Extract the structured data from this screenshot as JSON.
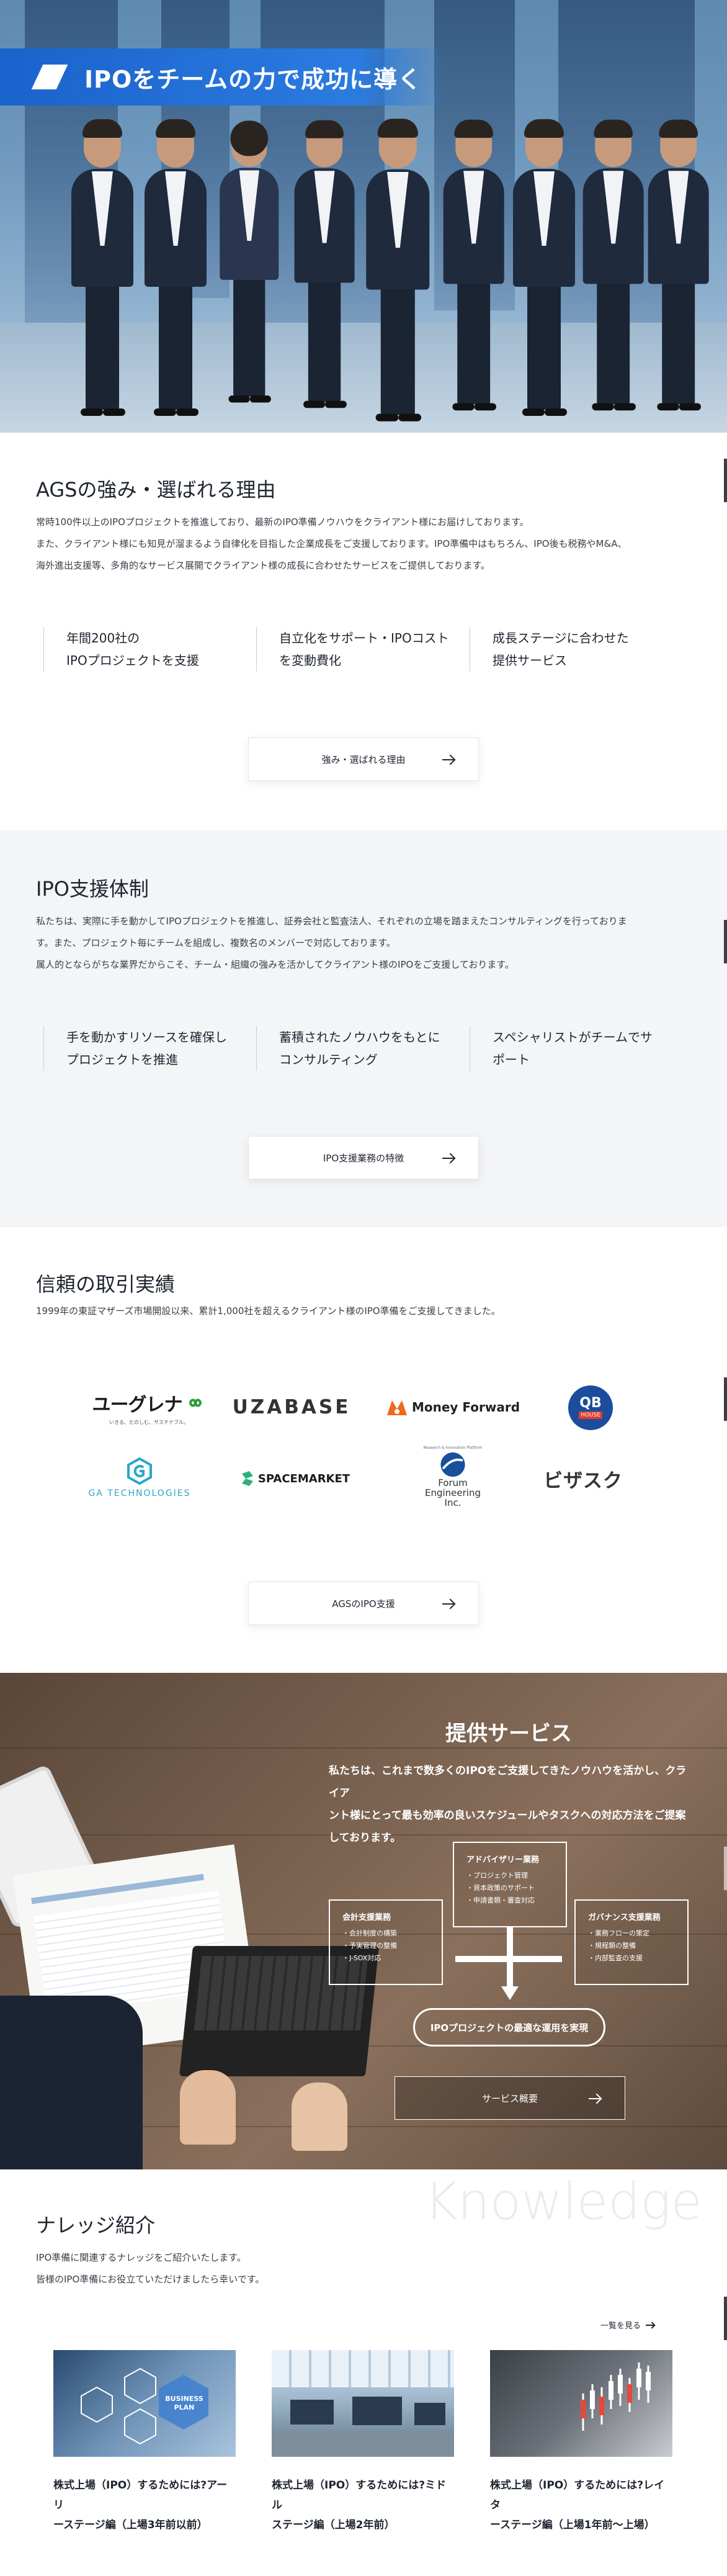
{
  "hero": {
    "title": "IPOをチームの力で成功に導く"
  },
  "strengths": {
    "title": "AGSの強み・選ばれる理由",
    "desc": [
      "常時100件以上のIPOプロジェクトを推進しており、最新のIPO準備ノウハウをクライアント様にお届けしております。",
      "また、クライアント様にも知見が溜まるよう自律化を目指した企業成長をご支援しております。IPO準備中はもちろん、IPO後も税務やM&A、",
      "海外進出支援等、多角的なサービス展開でクライアント様の成長に合わせたサービスをご提供しております。"
    ],
    "features": [
      [
        "年間200社の",
        "IPOプロジェクトを支援"
      ],
      [
        "自立化をサポート・IPOコスト",
        "を変動費化"
      ],
      [
        "成長ステージに合わせた",
        "提供サービス"
      ]
    ],
    "button": "強み・選ばれる理由"
  },
  "support": {
    "title": "IPO支援体制",
    "desc": [
      "私たちは、実際に手を動かしてIPOプロジェクトを推進し、証券会社と監査法人、それぞれの立場を踏まえたコンサルティングを行っておりま",
      "す。また、プロジェクト毎にチームを組成し、複数名のメンバーで対応しております。",
      "属人的とならがちな業界だからこそ、チーム・組織の強みを活かしてクライアント様のIPOをご支援しております。"
    ],
    "features": [
      [
        "手を動かすリソースを確保し",
        "プロジェクトを推進"
      ],
      [
        "蓄積されたノウハウをもとに",
        "コンサルティング"
      ],
      [
        "スペシャリストがチームでサ",
        "ポート"
      ]
    ],
    "button": "IPO支援業務の特徴"
  },
  "clients": {
    "title": "信頼の取引実績",
    "desc": "1999年の東証マザーズ市場開設以来、累計1,000社を超えるクライアント様のIPO準備をご支援してきました。",
    "logos": [
      {
        "name": "ユーグレナ",
        "sub": "いきる、たのしむ、サステナブル。",
        "icon": "euglena-logo-icon",
        "color": "#2f9d3a"
      },
      {
        "name": "UZABASE",
        "icon": "uzabase-logo-icon",
        "color": "#333333"
      },
      {
        "name": "Money Forward",
        "icon": "moneyforward-logo-icon",
        "color": "#f06a1d"
      },
      {
        "name": "QB HOUSE",
        "icon": "qbhouse-logo-icon",
        "color": "#1c4d9c"
      },
      {
        "name": "GA TECHNOLOGIES",
        "icon": "ga-technologies-logo-icon",
        "color": "#2aa6c8"
      },
      {
        "name": "SPACEMARKET",
        "icon": "spacemarket-logo-icon",
        "color": "#1b1b1b"
      },
      {
        "name": "Forum Engineering Inc.",
        "sub": "Research & Innovation Platform",
        "icon": "forum-engineering-logo-icon",
        "color": "#1a4f9c"
      },
      {
        "name": "ビザスク",
        "icon": "visasq-logo-icon",
        "color": "#333333"
      }
    ],
    "button": "AGSのIPO支援"
  },
  "services": {
    "title": "提供サービス",
    "desc": [
      "私たちは、これまで数多くのIPOをご支援してきたノウハウを活かし、クライア",
      "ント様にとって最も効率の良いスケジュールやタスクへの対応方法をご提案",
      "しております。"
    ],
    "boxes": {
      "advisory": {
        "title": "アドバイザリー業務",
        "items": [
          "・プロジェクト管理",
          "・資本政策のサポート",
          "・申請書類・審査対応"
        ]
      },
      "accounting": {
        "title": "会計支援業務",
        "items": [
          "・会計制度の構築",
          "・予実管理の整備",
          "・J-SOX対応"
        ]
      },
      "governance": {
        "title": "ガバナンス支援業務",
        "items": [
          "・業務フローの策定",
          "・規程類の整備",
          "・内部監査の支援"
        ]
      }
    },
    "pill": "IPOプロジェクトの最適な運用を実現",
    "button": "サービス概要"
  },
  "knowledge": {
    "bg_word": "Knowledge",
    "title": "ナレッジ紹介",
    "desc": [
      "IPO準備に関連するナレッジをご紹介いたします。",
      "皆様のIPO準備にお役立ていただけましたら幸いです。"
    ],
    "more": "一覧を見る",
    "cards": [
      {
        "title": [
          "株式上場（IPO）するためには?アーリ",
          "ーステージ編（上場3年前以前）"
        ],
        "thumb_text": "BUSINESS PLAN"
      },
      {
        "title": [
          "株式上場（IPO）するためには?ミドル",
          "ステージ編（上場2年前）"
        ]
      },
      {
        "title": [
          "株式上場（IPO）するためには?レイタ",
          "ーステージ編（上場1年前～上場）"
        ]
      }
    ]
  }
}
